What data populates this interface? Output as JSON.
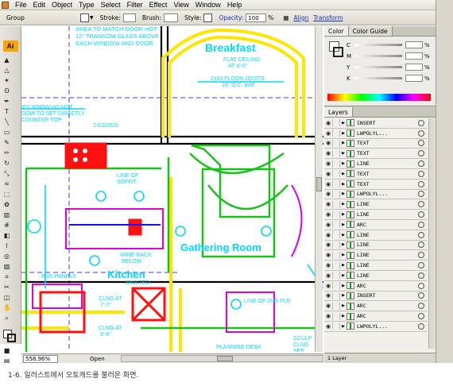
{
  "menu": [
    "File",
    "Edit",
    "Object",
    "Type",
    "Select",
    "Filter",
    "Effect",
    "View",
    "Window",
    "Help"
  ],
  "control_bar": {
    "selection": "Group",
    "stroke_label": "Stroke:",
    "brush_label": "Brush:",
    "style_label": "Style:",
    "opacity_label": "Opacity:",
    "opacity_value": "100",
    "opacity_unit": "%",
    "align_link": "Align",
    "transform_link": "Transform"
  },
  "toolbar": {
    "badge": "Ai"
  },
  "canvas": {
    "texts": {
      "area_note": "AREA TO MATCH DOOR HGT\n12\" TRANSOM GLASS ABOVE\nEACH WINDOW AND DOOR",
      "breakfast_title": "Breakfast",
      "breakfast_sub": "FLAT CEILING\nAT 8'-0\"",
      "joists": "2x10 FLOOR JOISTS\n16\" O.C. avel",
      "verify": "IFY WNDW HD HGT\nDOW TO SET DIRECTLY\nCOUNTER TOP",
      "ref_2cd": "2-CD2020",
      "line_soffit": "LINE OF\nSOFFIT",
      "gathering": "Gathering Room",
      "kitchen": "Kitchen",
      "vaulted": "VAULTED",
      "end_panels": "END PANELS",
      "wine_rack": "WINE RACK\nBELOW",
      "clng1": "CLNG AT\n7'-2\"",
      "clng2": "CLNG AT\n8'-6\"",
      "line_2nd": "LINE OF 2ND FLR",
      "planning": "PLANNING DESK",
      "sculp": "SCULP\nCLNG\nSEE"
    }
  },
  "color_panel": {
    "tabs": [
      "Color",
      "Color Guide"
    ],
    "channels": [
      {
        "label": "C",
        "value": ""
      },
      {
        "label": "M",
        "value": ""
      },
      {
        "label": "Y",
        "value": ""
      },
      {
        "label": "K",
        "value": ""
      }
    ],
    "unit": "%"
  },
  "layers_panel": {
    "tab": "Layers",
    "items": [
      "INSERT",
      "LWPOLYL...",
      "TEXT",
      "TEXT",
      "LINE",
      "TEXT",
      "TEXT",
      "LWPOLYL...",
      "LINE",
      "LINE",
      "ARC",
      "LINE",
      "LINE",
      "LINE",
      "LINE",
      "LINE",
      "ARC",
      "INSERT",
      "ARC",
      "ARC",
      "LWPOLYL..."
    ],
    "footer": "1 Layer"
  },
  "status_bar": {
    "zoom": "558.96%",
    "status": "Open"
  },
  "caption": "1-6. 일러스트에서 오토캐드를 불러온 화면."
}
